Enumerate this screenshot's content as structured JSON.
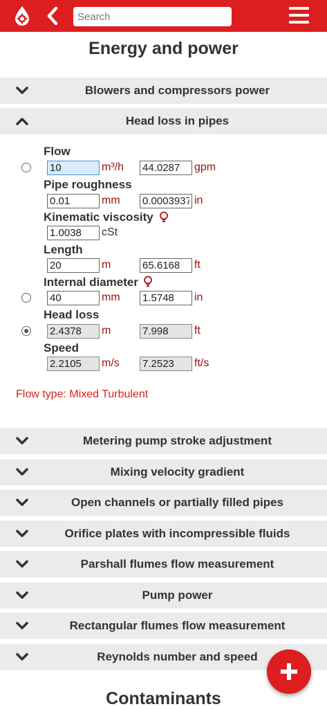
{
  "topbar": {
    "search_placeholder": "Search",
    "accent_color": "#dd1e1e",
    "icons": [
      "logo-icon",
      "back-arrow-icon",
      "hamburger-menu-icon"
    ]
  },
  "page_title": "Energy and power",
  "sections": {
    "blowers": "Blowers and compressors power",
    "head_loss": "Head loss in pipes",
    "metering": "Metering pump stroke adjustment",
    "mixing": "Mixing velocity gradient",
    "open_channels": "Open channels or partially filled pipes",
    "orifice": "Orifice plates with incompressible fluids",
    "parshall": "Parshall flumes flow measurement",
    "pump_power": "Pump power",
    "rectangular": "Rectangular flumes flow measurement",
    "reynolds": "Reynolds number and speed"
  },
  "form": {
    "flow": {
      "label": "Flow",
      "value1": "10",
      "unit1": "m³/h",
      "value2": "44.0287",
      "unit2": "gpm"
    },
    "roughness": {
      "label": "Pipe roughness",
      "value1": "0.01",
      "unit1": "mm",
      "value2": "0.0003937",
      "unit2": "in"
    },
    "viscosity": {
      "label": "Kinematic viscosity",
      "value1": "1.0038",
      "unit1": "cSt"
    },
    "length": {
      "label": "Length",
      "value1": "20",
      "unit1": "m",
      "value2": "65.6168",
      "unit2": "ft"
    },
    "diameter": {
      "label": "Internal diameter",
      "value1": "40",
      "unit1": "mm",
      "value2": "1.5748",
      "unit2": "in"
    },
    "head_loss": {
      "label": "Head loss",
      "value1": "2.4378",
      "unit1": "m",
      "value2": "7.998",
      "unit2": "ft"
    },
    "speed": {
      "label": "Speed",
      "value1": "2.2105",
      "unit1": "m/s",
      "value2": "7.2523",
      "unit2": "ft/s"
    }
  },
  "flow_type": "Flow type: Mixed Turbulent",
  "next_section_title": "Contaminants",
  "fab_icon": "plus-icon"
}
